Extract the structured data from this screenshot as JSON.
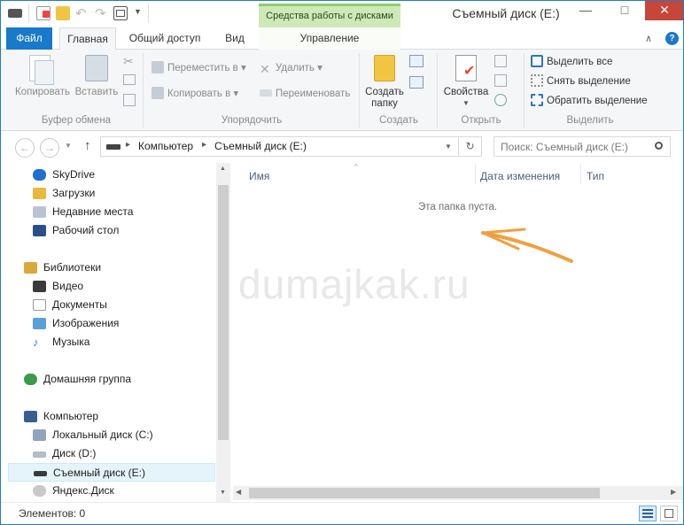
{
  "window": {
    "title": "Съемный диск (E:)",
    "context_tab_group": "Средства работы с дисками",
    "controls": {
      "minimize": "—",
      "maximize": "□",
      "close": "✕"
    }
  },
  "tabs": {
    "file": "Файл",
    "home": "Главная",
    "share": "Общий доступ",
    "view": "Вид",
    "manage": "Управление",
    "help": "?"
  },
  "ribbon": {
    "clipboard": {
      "label": "Буфер обмена",
      "copy": "Копировать",
      "paste": "Вставить"
    },
    "organize": {
      "label": "Упорядочить",
      "move_to": "Переместить в",
      "copy_to": "Копировать в",
      "delete": "Удалить",
      "rename": "Переименовать"
    },
    "create": {
      "label": "Создать",
      "new_folder_line1": "Создать",
      "new_folder_line2": "папку"
    },
    "open": {
      "label": "Открыть",
      "properties": "Свойства"
    },
    "select": {
      "label": "Выделить",
      "select_all": "Выделить все",
      "select_none": "Снять выделение",
      "invert": "Обратить выделение"
    }
  },
  "address": {
    "crumbs": [
      "Компьютер",
      "Съемный диск (E:)"
    ],
    "search_placeholder": "Поиск: Съемный диск (E:)"
  },
  "nav_pane": {
    "skydrive": "SkyDrive",
    "downloads": "Загрузки",
    "recent": "Недавние места",
    "desktop": "Рабочий стол",
    "libraries": "Библиотеки",
    "video": "Видео",
    "documents": "Документы",
    "pictures": "Изображения",
    "music": "Музыка",
    "homegroup": "Домашняя группа",
    "computer": "Компьютер",
    "local_c": "Локальный диск (C:)",
    "disk_d": "Диск (D:)",
    "removable_e": "Съемный диск (E:)",
    "yandex": "Яндекс.Диск"
  },
  "content": {
    "columns": [
      "Имя",
      "Дата изменения",
      "Тип"
    ],
    "empty_message": "Эта папка пуста.",
    "watermark": "dumajkak.ru"
  },
  "status": {
    "items": "Элементов: 0"
  },
  "colors": {
    "accent": "#1979ca",
    "context_tab": "#cde9b8",
    "close": "#c7463a",
    "arrow": "#f0a040"
  }
}
